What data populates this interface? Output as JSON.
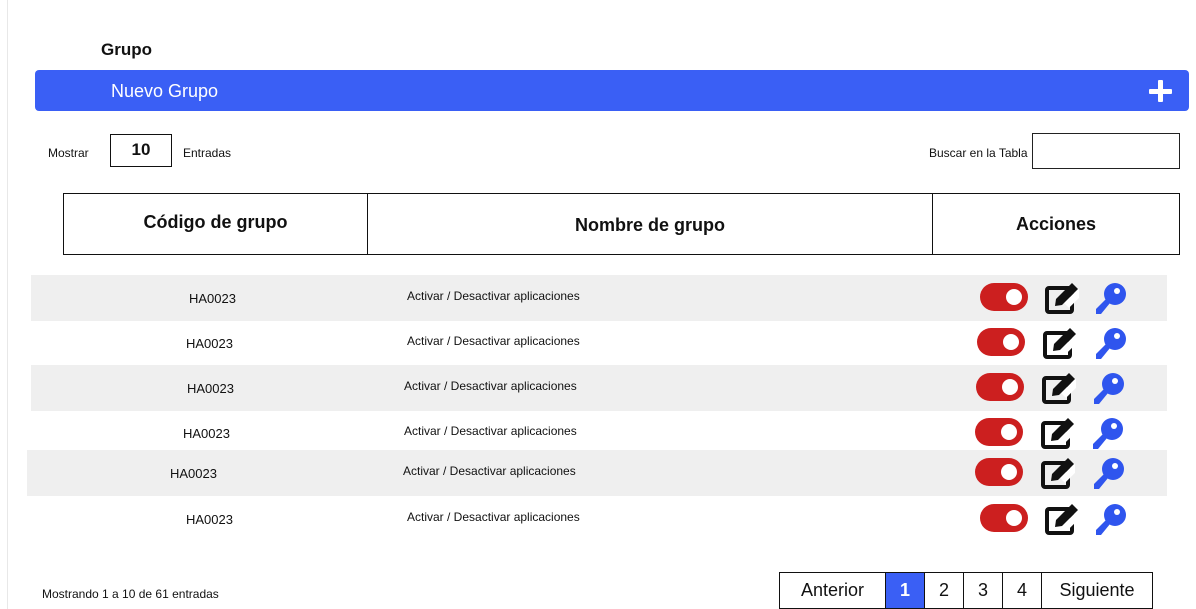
{
  "page": {
    "title": "Grupo"
  },
  "new_group": {
    "label": "Nuevo Grupo",
    "icon": "plus-icon"
  },
  "controls": {
    "show_label": "Mostrar",
    "show_value": "10",
    "entries_label": "Entradas",
    "search_label": "Buscar en la Tabla",
    "search_value": ""
  },
  "table": {
    "headers": [
      "Código de grupo",
      "Nombre de grupo",
      "Acciones"
    ],
    "rows": [
      {
        "code": "HA0023",
        "name": "Activar / Desactivar aplicaciones",
        "active": true
      },
      {
        "code": "HA0023",
        "name": "Activar / Desactivar aplicaciones",
        "active": true
      },
      {
        "code": "HA0023",
        "name": "Activar / Desactivar aplicaciones",
        "active": true
      },
      {
        "code": "HA0023",
        "name": "Activar / Desactivar aplicaciones",
        "active": true
      },
      {
        "code": "HA0023",
        "name": "Activar / Desactivar aplicaciones",
        "active": true
      },
      {
        "code": "HA0023",
        "name": "Activar / Desactivar aplicaciones",
        "active": true
      }
    ],
    "action_icons": [
      "toggle-switch",
      "edit-icon",
      "key-icon"
    ]
  },
  "footer": {
    "info": "Mostrando 1 a 10 de 61 entradas",
    "pagination": {
      "prev": "Anterior",
      "pages": [
        "1",
        "2",
        "3",
        "4"
      ],
      "current": "1",
      "next": "Siguiente"
    }
  },
  "colors": {
    "accent": "#3a5ff5",
    "toggle_on": "#cc1f1f",
    "key_icon": "#2f55ee",
    "row_shade": "#efefef"
  }
}
